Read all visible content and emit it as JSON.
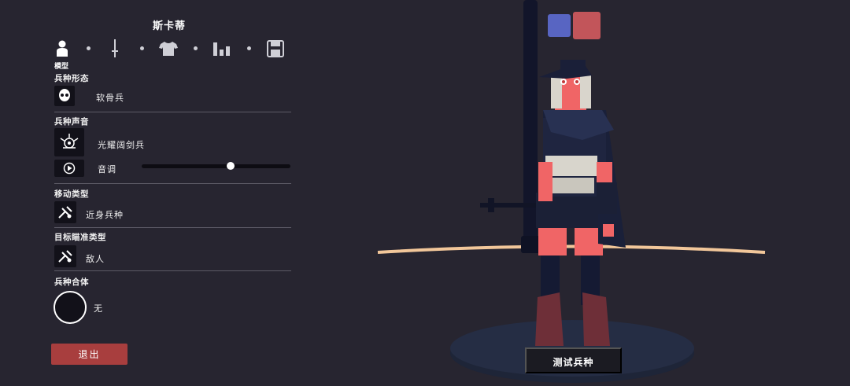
{
  "panel": {
    "title": "斯卡蒂",
    "tabs": [
      {
        "icon": "person-icon",
        "label": "模型"
      },
      {
        "icon": "sword-icon"
      },
      {
        "icon": "shirt-icon"
      },
      {
        "icon": "stats-icon"
      },
      {
        "icon": "save-icon"
      }
    ],
    "sections": {
      "form": {
        "label": "兵种形态",
        "value": "软骨兵"
      },
      "voice": {
        "label": "兵种声音",
        "value": "光耀阔剑兵",
        "pitch_label": "音调",
        "pitch_level": 0.6
      },
      "move": {
        "label": "移动类型",
        "value": "近身兵种"
      },
      "target": {
        "label": "目标瞄准类型",
        "value": "敌人"
      },
      "merge": {
        "label": "兵种合体",
        "value": "无"
      }
    },
    "exit_button": "退出"
  },
  "scene": {
    "team_colors": [
      "#5865c2",
      "#c2555a"
    ],
    "test_button": "测试兵种"
  }
}
